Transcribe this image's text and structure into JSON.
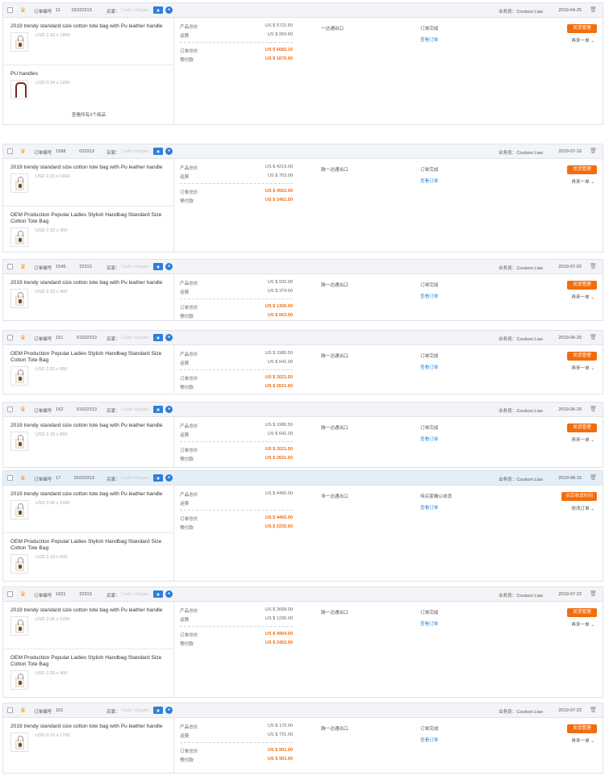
{
  "labels": {
    "order_no": "订单编号",
    "buyer": "买家：",
    "salesperson": "业务员：",
    "product_total": "产品总价",
    "shipping": "运费",
    "order_total": "订单总价",
    "prepaid": "预付款",
    "view_order": "查看订单",
    "view_all": "查看所有3个商品"
  },
  "colors": {
    "accent": "#f36c0e",
    "link": "#2d88d9",
    "highlight_header": "#e3eff8"
  },
  "orders": [
    {
      "order_no": "11     01022313",
      "order_no_label": "订单编号",
      "buyer": "Carlin Vanges",
      "sales": "业务员：Coulson Liao",
      "date": "2019-04-25",
      "action": "发货管理",
      "more": "再来一单",
      "shipping_method": "一达通出口",
      "status": "订单完成",
      "product_total": "US $ 5722.50",
      "shipping_fee": "US $ 959.60",
      "order_total": "US $ 6682.10",
      "prepaid": "US $ 1670.00",
      "view_all": "查看所有3个商品",
      "products": [
        {
          "name": "2019 trendy standard size cotton tote bag with Pu leather handle",
          "sku": "USD 2.33 x 1860"
        },
        {
          "name": "PU handles",
          "sku": "USD 0.34 x 1280"
        }
      ]
    },
    {
      "order_no": "1598      022313",
      "order_no_label": "订单编号",
      "buyer": "Carlin Vanges",
      "sales": "业务员：Coulson Liao",
      "date": "2019-07-16",
      "action": "发货管理",
      "more": "再来一单",
      "shipping_method": "跨一达通出口",
      "status": "订单完成",
      "product_total": "US $ 4219.00",
      "shipping_fee": "US $ 703.00",
      "order_total": "US $ 4922.00",
      "prepaid": "US $ 2461.00",
      "products": [
        {
          "name": "2019 trendy standard size cotton tote bag with Pu leather handle",
          "sku": "USD 2.20 x 1600"
        },
        {
          "name": "OEM Production Popular Ladies Stylish Handbag Standard Size Cotton Tote Bag",
          "sku": "USD 2.33 x 300"
        }
      ]
    },
    {
      "order_no": "1545      22313",
      "order_no_label": "订单编号",
      "buyer": "Carlin Vanges",
      "sales": "业务员：Coulson Liao",
      "date": "2019-07-02",
      "action": "发货管理",
      "more": "再来一单",
      "shipping_method": "跨一达通出口",
      "status": "订单完成",
      "product_total": "US $ 932.00",
      "shipping_fee": "US $ 374.00",
      "order_total": "US $ 1306.00",
      "prepaid": "US $ 663.00",
      "products": [
        {
          "name": "2019 trendy standard size cotton tote bag with Pu leather handle",
          "sku": "USD 2.33 x 400"
        }
      ]
    },
    {
      "order_no": "151      01022313",
      "order_no_label": "订单编号",
      "buyer": "Carlin Vanges",
      "sales": "业务员：Coulson Liao",
      "date": "2019-06-25",
      "action": "发货管理",
      "more": "再来一单",
      "shipping_method": "跨一达通出口",
      "status": "订单完成",
      "product_total": "US $ 1980.50",
      "shipping_fee": "US $ 641.00",
      "order_total": "US $ 2621.50",
      "prepaid": "US $ 2621.50",
      "products": [
        {
          "name": "OEM Production Popular Ladies Stylish Handbag Standard Size Cotton Tote Bag",
          "sku": "USD 2.33 x 850"
        }
      ]
    },
    {
      "order_no": "152      01022313",
      "order_no_label": "订单编号",
      "buyer": "Carlin Vanges",
      "sales": "业务员：Coulson Liao",
      "date": "2019-06-25",
      "action": "发货管理",
      "more": "再来一单",
      "shipping_method": "跨一达通出口",
      "status": "订单完成",
      "product_total": "US $ 1980.50",
      "shipping_fee": "US $ 641.00",
      "order_total": "US $ 2621.50",
      "prepaid": "US $ 2621.50",
      "products": [
        {
          "name": "2019 trendy standard size cotton tote bag with Pu leather handle",
          "sku": "USD 2.33 x 850"
        }
      ]
    },
    {
      "order_no": "17      01022313",
      "order_no_label": "订单编号",
      "buyer": "Carlin Vanges",
      "sales": "业务员：Coulson Liao",
      "date": "2019-08-15",
      "action": "买后收货时间",
      "more": "修改订单",
      "shipping_method": "非一达通出口",
      "status": "待买家确认收货",
      "product_total": "US $ 4465.00",
      "shipping_fee": "",
      "order_total": "US $ 4465.00",
      "prepaid": "US $ 2232.50",
      "products": [
        {
          "name": "2019 trendy standard size cotton tote bag with Pu leather handle",
          "sku": "USD 2.20 x 1500"
        },
        {
          "name": "OEM Production Popular Ladies Stylish Handbag Standard Size Cotton Tote Bag",
          "sku": "USD 2.33 x 500"
        }
      ]
    },
    {
      "order_no": "1621      22313",
      "order_no_label": "订单编号",
      "buyer": "Carlin Vanges",
      "sales": "业务员：Coulson Liao",
      "date": "2019-07-22",
      "action": "发货管理",
      "more": "再来一单",
      "shipping_method": "跨一达通出口",
      "status": "订单完成",
      "product_total": "US $ 3668.00",
      "shipping_fee": "US $ 1236.00",
      "order_total": "US $ 4904.00",
      "prepaid": "US $ 2452.00",
      "products": [
        {
          "name": "2019 trendy standard size cotton tote bag with Pu leather handle",
          "sku": "USD 2.26 x 1200"
        },
        {
          "name": "OEM Production Popular Ladies Stylish Handbag Standard Size Cotton Tote Bag",
          "sku": "USD 2.33 x 400"
        }
      ]
    },
    {
      "order_no": "161        ",
      "order_no_label": "订单编号",
      "buyer": "Carlin Vanges",
      "sales": "业务员：Coulson Liao",
      "date": "2019-07-22",
      "action": "发货管理",
      "more": "再来一单",
      "shipping_method": "跨一达通出口",
      "status": "订单完成",
      "product_total": "US $ 170.00",
      "shipping_fee": "US $ 731.00",
      "order_total": "US $ 901.00",
      "prepaid": "US $ 901.00",
      "products": [
        {
          "name": "2019 trendy standard size cotton tote bag with Pu leather handle",
          "sku": "USD 0.10 x 1700"
        }
      ]
    }
  ]
}
